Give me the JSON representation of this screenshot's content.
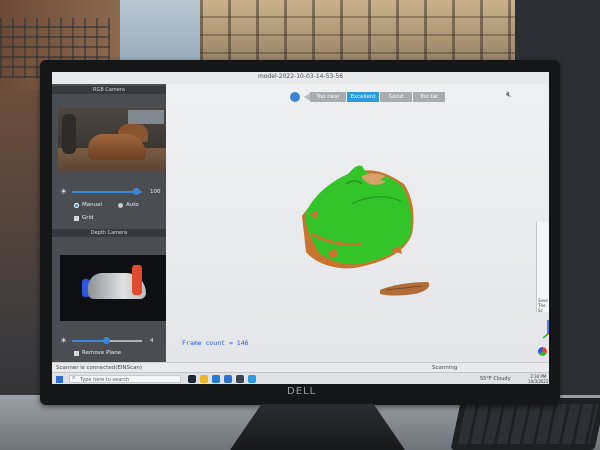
{
  "app": {
    "title": "model-2022-10-03-14-53-56"
  },
  "left_panel": {
    "rgb_camera_label": "RGB Camera",
    "exposure_value": "100",
    "exposure_fraction": 0.92,
    "mode_options": [
      "Manual",
      "Auto"
    ],
    "mode_selected": "Manual",
    "grid_label": "Grid",
    "depth_camera_label": "Depth Camera",
    "depth_value": "4",
    "depth_fraction": 0.48,
    "remove_plane_label": "Remove Plane"
  },
  "viewport": {
    "distance_options": [
      "Too near",
      "Excellent",
      "Good",
      "Too far"
    ],
    "distance_selected": "Excellent",
    "frame_count_text": "Frame count = 146"
  },
  "status_bar": {
    "left_text": "Scanner is connected(EINScan)",
    "right_text": "Scanning"
  },
  "taskbar": {
    "search_placeholder": "Type here to search",
    "weather": "55°F  Cloudy",
    "clock_time": "2:34 PM",
    "clock_date": "10/3/2022"
  },
  "peek_window": {
    "text": "Save\nThe Sc"
  },
  "colors": {
    "accent": "#2a9be0",
    "model_green": "#33c42a",
    "model_orange": "#c9742e",
    "frame_count_blue": "#2f5bd1"
  },
  "icons": {
    "exposure": "sun-icon",
    "sound": "mute-icon",
    "axis": "axis-gizmo-icon"
  }
}
